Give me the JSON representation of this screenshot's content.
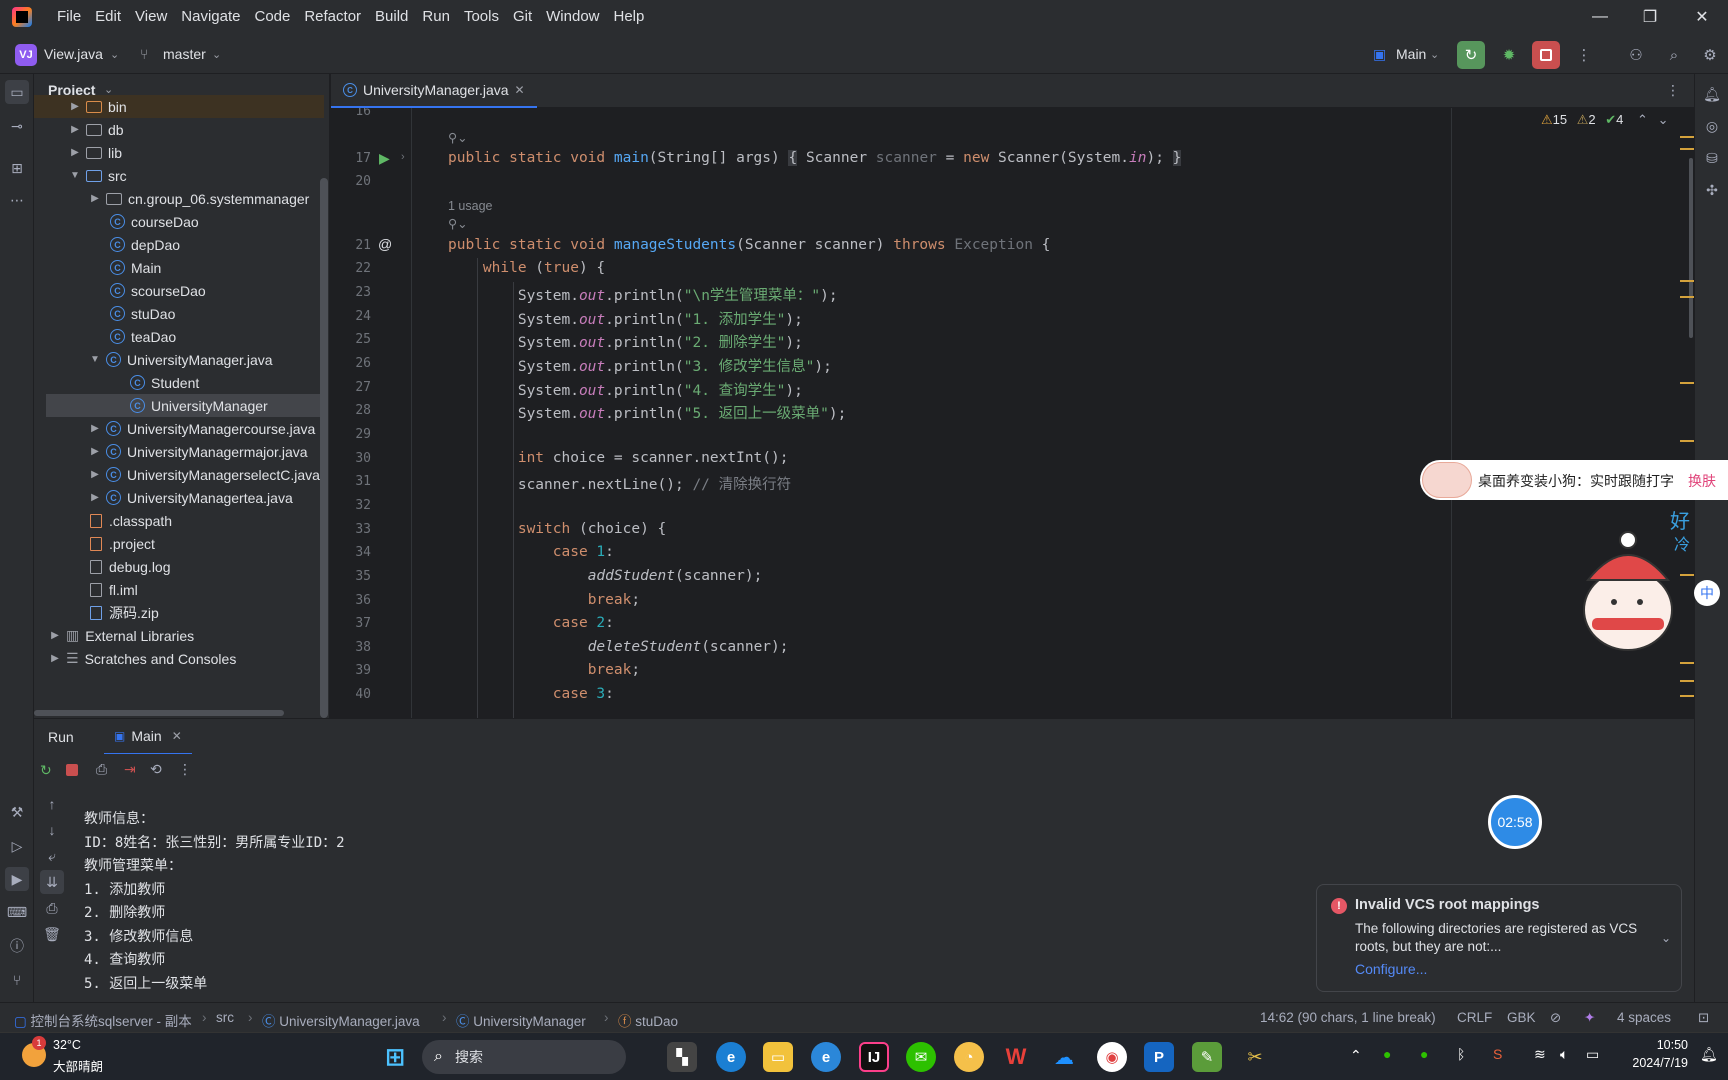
{
  "titlebar": {
    "menu": [
      "File",
      "Edit",
      "View",
      "Navigate",
      "Code",
      "Refactor",
      "Build",
      "Run",
      "Tools",
      "Git",
      "Window",
      "Help"
    ]
  },
  "toolbar": {
    "project_badge": "VJ",
    "project_name": "View.java",
    "branch": "master",
    "run_config": "Main"
  },
  "project_panel": {
    "title": "Project",
    "items": [
      {
        "label": "bin",
        "type": "folder",
        "indent": 1
      },
      {
        "label": "db",
        "type": "folder",
        "indent": 1
      },
      {
        "label": "lib",
        "type": "folder",
        "indent": 1
      },
      {
        "label": "src",
        "type": "folder",
        "indent": 1
      },
      {
        "label": "cn.group_06.systemmanager",
        "type": "package",
        "indent": 2
      },
      {
        "label": "courseDao",
        "type": "class",
        "indent": 2
      },
      {
        "label": "depDao",
        "type": "class",
        "indent": 2
      },
      {
        "label": "Main",
        "type": "class",
        "indent": 2
      },
      {
        "label": "scourseDao",
        "type": "class",
        "indent": 2
      },
      {
        "label": "stuDao",
        "type": "class",
        "indent": 2
      },
      {
        "label": "teaDao",
        "type": "class",
        "indent": 2
      },
      {
        "label": "UniversityManager.java",
        "type": "class",
        "indent": 2
      },
      {
        "label": "Student",
        "type": "class",
        "indent": 3
      },
      {
        "label": "UniversityManager",
        "type": "class",
        "indent": 3
      },
      {
        "label": "UniversityManagercourse.java",
        "type": "class",
        "indent": 2
      },
      {
        "label": "UniversityManagermajor.java",
        "type": "class",
        "indent": 2
      },
      {
        "label": "UniversityManagerselectC.java",
        "type": "class",
        "indent": 2
      },
      {
        "label": "UniversityManagertea.java",
        "type": "class",
        "indent": 2
      },
      {
        "label": ".classpath",
        "type": "file",
        "indent": 1
      },
      {
        "label": ".project",
        "type": "file",
        "indent": 1
      },
      {
        "label": "debug.log",
        "type": "file",
        "indent": 1
      },
      {
        "label": "fl.iml",
        "type": "file",
        "indent": 1
      },
      {
        "label": "源码.zip",
        "type": "file",
        "indent": 1
      },
      {
        "label": "External Libraries",
        "type": "lib",
        "indent": 0
      },
      {
        "label": "Scratches and Consoles",
        "type": "lib",
        "indent": 0
      }
    ]
  },
  "editor": {
    "tab": "UniversityManager.java",
    "inspections": {
      "warnings": "15",
      "weak": "2",
      "ok": "4"
    },
    "usage_hint": "1 usage",
    "lines": {
      "n16": "16",
      "n17": "17",
      "n20": "20",
      "n21": "21",
      "n22": "22",
      "n23": "23",
      "n24": "24",
      "n25": "25",
      "n26": "26",
      "n27": "27",
      "n28": "28",
      "n29": "29",
      "n30": "30",
      "n31": "31",
      "n32": "32",
      "n33": "33",
      "n34": "34",
      "n35": "35",
      "n36": "36",
      "n37": "37",
      "n38": "38",
      "n39": "39",
      "n40": "40"
    }
  },
  "run_panel": {
    "tab_run": "Run",
    "tab_main": "Main",
    "console": [
      "教师信息：",
      "ID：8姓名：张三性别：男所属专业ID：2",
      "教师管理菜单：",
      "1. 添加教师",
      "2. 删除教师",
      "3. 修改教师信息",
      "4. 查询教师",
      "5. 返回上一级菜单"
    ]
  },
  "notification": {
    "title": "Invalid VCS root mappings",
    "body": "The following directories are registered as VCS roots, but they are not:...",
    "action": "Configure..."
  },
  "statusbar": {
    "crumbs": [
      "控制台系统sqlserver - 副本",
      "src",
      "UniversityManager.java",
      "UniversityManager",
      "stuDao"
    ],
    "position": "14:62 (90 chars, 1 line break)",
    "line_sep": "CRLF",
    "encoding": "GBK",
    "indent": "4 spaces"
  },
  "overlay": {
    "timer": "02:58",
    "pet_text": "桌面养变装小狗：实时跟随打字",
    "pet_action": "换肤"
  },
  "taskbar": {
    "weather_temp": "32°C",
    "weather_desc": "大部晴朗",
    "weather_badge": "1",
    "search_placeholder": "搜索",
    "time": "10:50",
    "date": "2024/7/19"
  },
  "colors": {
    "accent": "#3574f0",
    "keyword": "#cf8e6d",
    "function": "#56a8f5",
    "string": "#6aab73",
    "error": "#e55765"
  }
}
